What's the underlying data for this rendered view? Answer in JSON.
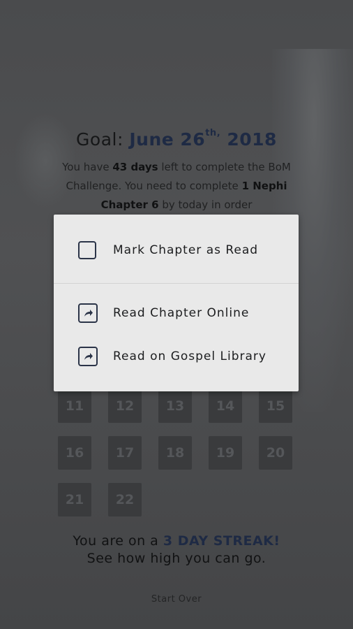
{
  "goal": {
    "prefix": "Goal: ",
    "month_day": "June 26",
    "suffix": "th,",
    "year": " 2018"
  },
  "intro": {
    "part1": "You have ",
    "days": "43 days",
    "part2": " left to complete the BoM Challenge. You need to complete ",
    "chapter": "1 Nephi Chapter 6",
    "part3": " by today in order"
  },
  "chapter_grid": [
    "11",
    "12",
    "13",
    "14",
    "15",
    "16",
    "17",
    "18",
    "19",
    "20",
    "21",
    "22"
  ],
  "streak": {
    "line1_prefix": "You are on a ",
    "highlight": "3 DAY STREAK!",
    "line2": "See how high you can go."
  },
  "start_over_label": "Start Over",
  "dialog": {
    "mark_read": "Mark Chapter as Read",
    "read_online": "Read Chapter Online",
    "read_gospel_library": "Read on Gospel Library"
  },
  "colors": {
    "accent": "#1e2a44",
    "dialog_bg": "#e9e9e9",
    "overlay": "#3f4042"
  },
  "icons": {
    "checkbox": "checkbox-empty-icon",
    "external": "external-link-icon"
  }
}
